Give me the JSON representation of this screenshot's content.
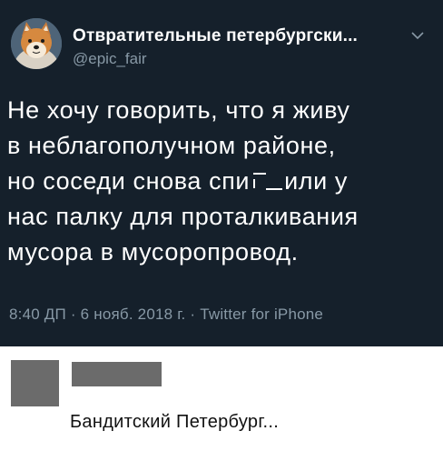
{
  "tweet": {
    "display_name": "Отвратительные петербургски...",
    "handle": "@epic_fair",
    "text_lines": [
      "Не хочу говорить, что я живу",
      "в неблагополучном районе,",
      "но соседи снова спи",
      "или у",
      "нас палку для проталкивания",
      "мусора в мусоропровод."
    ],
    "meta": {
      "time": "8:40 ДП",
      "separator": " · ",
      "date": "6 нояб. 2018 г.",
      "source": "Twitter for iPhone"
    }
  },
  "caption": {
    "text": "Бандитский Петербург..."
  },
  "icons": {
    "avatar": "shiba-inu-avatar-icon",
    "chevron": "chevron-down-icon"
  },
  "colors": {
    "tweet_background": "#15202b",
    "secondary_text": "#8899a6",
    "redaction": "#6b6b6b",
    "page_background": "#ffffff"
  }
}
